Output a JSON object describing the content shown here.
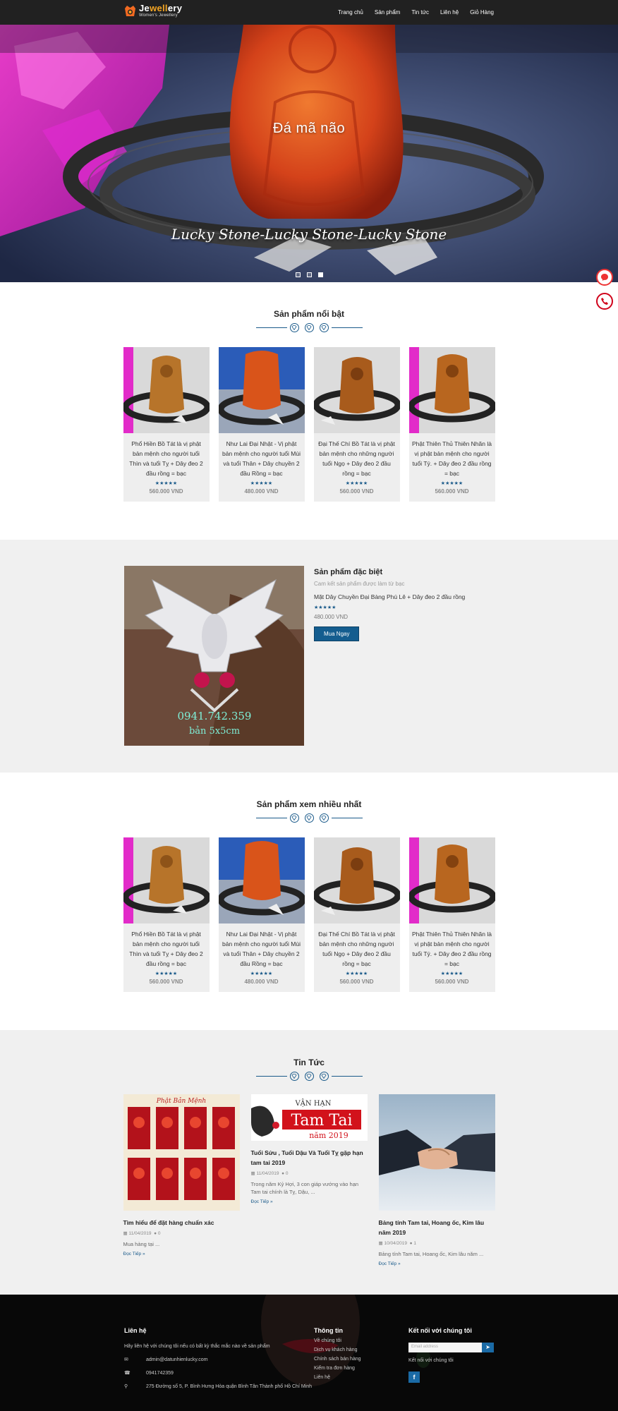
{
  "header": {
    "logo_prefix": "Je",
    "logo_accent": "well",
    "logo_suffix": "ery",
    "logo_sub": "Women's Jewellery",
    "nav": [
      "Trang chủ",
      "Sản phẩm",
      "Tin tức",
      "Liên hệ",
      "Giỏ Hàng"
    ]
  },
  "hero": {
    "caption": "Đá mã não",
    "subtitle": "Lucky  Stone-Lucky  Stone-Lucky  Stone",
    "slides": 3,
    "active_slide": 3
  },
  "featured": {
    "title": "Sản phẩm nổi bật",
    "products": [
      {
        "name": "Phổ Hiền Bồ Tát là vị phật bản mệnh cho người tuổi Thìn và tuổi Tỵ + Dây đeo 2 đầu rồng = bạc",
        "stars": "★★★★★",
        "price": "560.000 VND"
      },
      {
        "name": "Như Lai Đại Nhật - Vị phật bản mệnh cho người tuổi Mùi và tuổi Thân + Dây chuyền 2 đầu Rồng = bạc",
        "stars": "★★★★★",
        "price": "480.000 VND"
      },
      {
        "name": "Đại Thế Chí Bồ Tát là vị phật bản mệnh cho những người tuổi Ngọ + Dây đeo 2 đầu rồng = bạc",
        "stars": "★★★★★",
        "price": "560.000 VND"
      },
      {
        "name": "Phật Thiên Thủ Thiên Nhãn là vị phật bản mệnh cho người tuổi Tý. + Dây đeo 2 đầu rồng = bạc",
        "stars": "★★★★★",
        "price": "560.000 VND"
      }
    ]
  },
  "special": {
    "title": "Sản phẩm đặc biệt",
    "subtitle": "Cam kết sản phẩm được làm từ bạc",
    "name": "Mặt Dây Chuyền Đại Bàng Phú Lê + Dây đeo 2 đầu rồng",
    "stars": "★★★★★",
    "price": "480.000 VND",
    "button": "Mua Ngay",
    "image_phone": "0941.742.359",
    "image_size": "bản 5x5cm"
  },
  "most_viewed": {
    "title": "Sản phẩm xem nhiều nhất",
    "products": [
      {
        "name": "Phổ Hiền Bồ Tát là vị phật bản mệnh cho người tuổi Thìn và tuổi Tỵ + Dây đeo 2 đầu rồng = bạc",
        "stars": "★★★★★",
        "price": "560.000 VND"
      },
      {
        "name": "Như Lai Đại Nhật - Vị phật bản mệnh cho người tuổi Mùi và tuổi Thân + Dây chuyền 2 đầu Rồng = bạc",
        "stars": "★★★★★",
        "price": "480.000 VND"
      },
      {
        "name": "Đại Thế Chí Bồ Tát là vị phật bản mệnh cho những người tuổi Ngọ + Dây đeo 2 đầu rồng = bạc",
        "stars": "★★★★★",
        "price": "560.000 VND"
      },
      {
        "name": "Phật Thiên Thủ Thiên Nhãn là vị phật bản mệnh cho người tuổi Tý. + Dây đeo 2 đầu rồng = bạc",
        "stars": "★★★★★",
        "price": "560.000 VND"
      }
    ]
  },
  "news": {
    "title": "Tin Tức",
    "posts": [
      {
        "title": "Tìm hiểu để đặt hàng chuẩn xác",
        "date": "11/04/2019",
        "comments": "0",
        "excerpt": "Mua hàng tại ...",
        "more": "Đọc Tiếp »",
        "img_title": "Phật Bản Mệnh"
      },
      {
        "title": "Tuổi Sửu , Tuổi Dậu Và Tuổi Tỵ gặp hạn tam tai 2019",
        "date": "11/04/2019",
        "comments": "0",
        "excerpt": "Trong năm Kỷ Hợi, 3 con giáp vướng vào hạn Tam tai chính là Tỵ, Dậu, ...",
        "more": "Đọc Tiếp »",
        "img_line1": "VẬN HẠN",
        "img_line2": "Tam Tai",
        "img_line3": "năm 2019"
      },
      {
        "title": "Bảng tính Tam tai, Hoang ốc, Kim lâu năm 2019",
        "date": "10/04/2019",
        "comments": "1",
        "excerpt": "Bảng tính Tam tai, Hoang ốc, Kim lâu năm ...",
        "more": "Đọc Tiếp »"
      }
    ]
  },
  "footer": {
    "contact_title": "Liên hệ",
    "contact_text": "Hãy liên hệ với chúng tôi nếu có bất kỳ thắc mắc nào về sản phẩm",
    "email": "admin@datunhienlucky.com",
    "phone": "0941742359",
    "address": "275 Đường số 5, P. Bình Hưng Hòa quận Bình Tân Thành phố Hồ Chí Minh",
    "info_title": "Thông tin",
    "info_links": [
      "Về chúng tôi",
      "Dịch vụ khách hàng",
      "Chính sách bán hàng",
      "Kiểm tra đơn hàng",
      "Liên hệ"
    ],
    "connect_title": "Kết nối với chúng tôi",
    "email_placeholder": "Email address",
    "connect_text": "Kết nối với chúng tôi",
    "facebook": "f"
  }
}
